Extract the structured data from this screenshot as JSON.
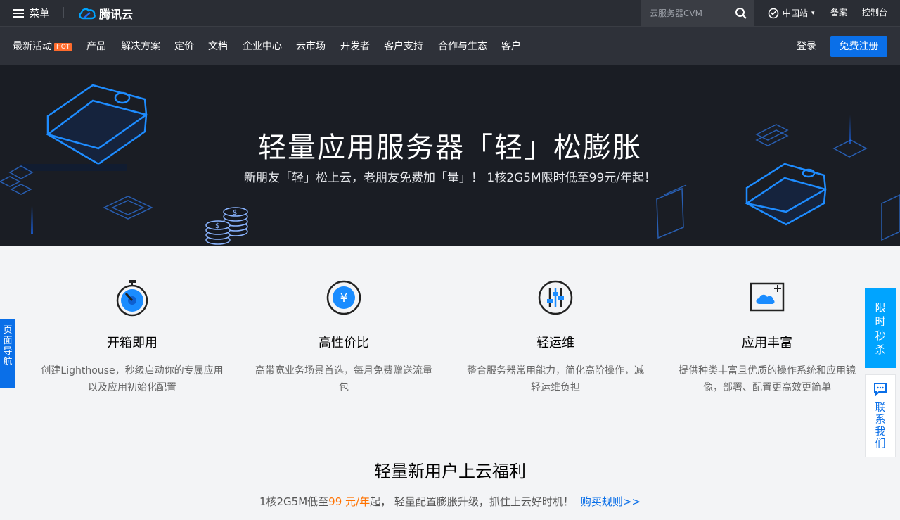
{
  "topbar": {
    "menu_label": "菜单",
    "brand": "腾讯云",
    "search_placeholder": "云服务器CVM",
    "region": "中国站",
    "links": [
      "备案",
      "控制台"
    ]
  },
  "nav": {
    "items": [
      "最新活动",
      "产品",
      "解决方案",
      "定价",
      "文档",
      "企业中心",
      "云市场",
      "开发者",
      "客户支持",
      "合作与生态",
      "客户"
    ],
    "hot_badge": "HOT",
    "login": "登录",
    "signup": "免费注册"
  },
  "hero": {
    "title": "轻量应用服务器「轻」松膨胀",
    "subtitle": "新朋友「轻」松上云，老朋友免费加「量」！ 1核2G5M限时低至99元/年起！"
  },
  "features": [
    {
      "icon": "stopwatch-icon",
      "title": "开箱即用",
      "desc": "创建Lighthouse，秒级启动你的专属应用以及应用初始化配置"
    },
    {
      "icon": "yuan-coin-icon",
      "title": "高性价比",
      "desc": "高带宽业务场景首选，每月免费赠送流量包"
    },
    {
      "icon": "sliders-icon",
      "title": "轻运维",
      "desc": "整合服务器常用能力，简化高阶操作，减轻运维负担"
    },
    {
      "icon": "cloud-add-icon",
      "title": "应用丰富",
      "desc": "提供种类丰富且优质的操作系统和应用镜像，部署、配置更高效更简单"
    }
  ],
  "promo": {
    "title": "轻量新用户上云福利",
    "sub_prefix": "1核2G5M低至",
    "price": "99 元/年",
    "sub_suffix": "起， 轻量配置膨胀升级，抓住上云好时机！",
    "rules_link": "购买规则>>"
  },
  "side": {
    "page_nav": "页面导航",
    "flash_sale": "限时秒杀",
    "contact": "联系我们"
  },
  "colors": {
    "brand_blue": "#0a6fe8",
    "accent_orange": "#ff7200",
    "hero_bg": "#1a1d24",
    "topbar_bg": "#2a2d34"
  }
}
